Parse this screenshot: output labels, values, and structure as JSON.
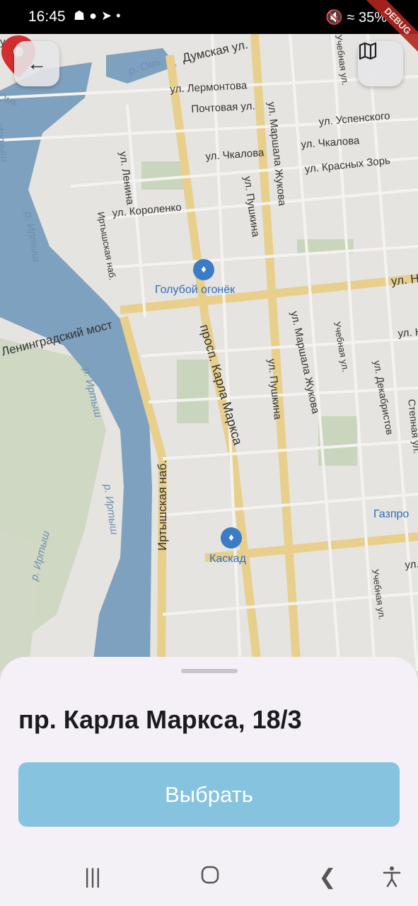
{
  "status_bar": {
    "time": "16:45",
    "left_icons": [
      "bag-icon",
      "account-icon",
      "telegram-icon",
      "dot-icon"
    ],
    "right_icons": [
      "mute-icon",
      "wifi-icon",
      "signal-icon"
    ],
    "battery": "35%",
    "debug_banner": "DEBUG"
  },
  "map": {
    "streets": [
      "Думская ул.",
      "ул. Лермонтова",
      "Почтовая ул.",
      "ул. Успенского",
      "ул. Чкалова",
      "ул. Чкалова",
      "ул. Красных Зорь",
      "ул. Ленина",
      "ул. Короленко",
      "ул. Пушкина",
      "ул. Маршала Жукова",
      "Иртышская наб.",
      "Ленинградский мост",
      "просп. Карла Маркса",
      "ул. Пушкина",
      "ул. Маршала Жукова",
      "Учебная ул.",
      "ул. Декабристов",
      "Степная ул.",
      "Иртышская наб.",
      "Учебная ул.",
      "ул. Н",
      "ул. Н",
      "ул. Н",
      "ул. Н",
      "Учебная ул.",
      "р. Омь",
      "Омь"
    ],
    "rivers": [
      "р. Иртыш",
      "р. Иртыш",
      "р. Иртыш",
      "р. Иртыш",
      "р. Иртыш",
      "Иртыш"
    ],
    "pois": [
      "Голубой огонёк",
      "Каскад",
      "Газпро"
    ]
  },
  "address": "пр. Карла Маркса, 18/3",
  "select_button": "Выбрать",
  "nav": {
    "recent_apps": "recent-apps-icon",
    "home": "home-icon",
    "back": "back-icon",
    "accessibility": "accessibility-icon"
  }
}
